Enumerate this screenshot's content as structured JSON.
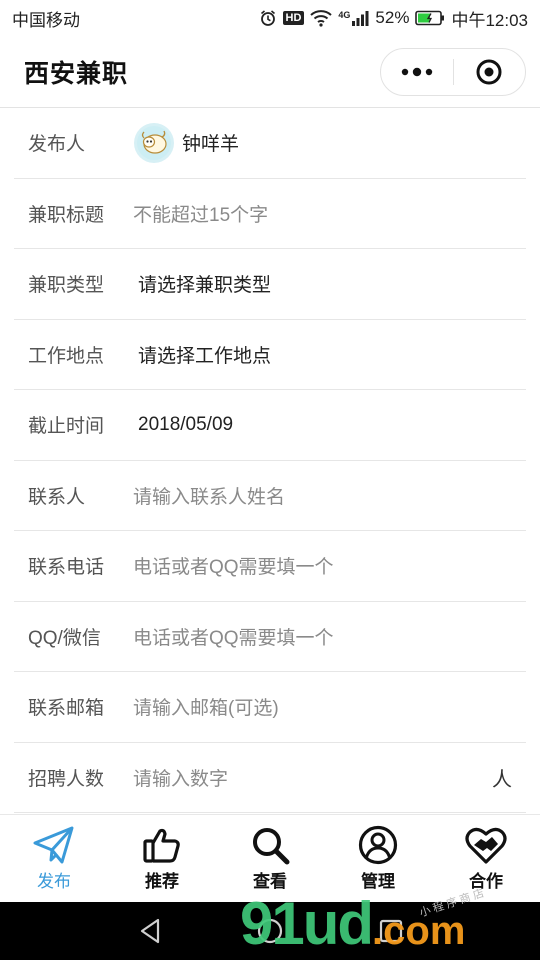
{
  "status_bar": {
    "carrier": "中国移动",
    "signal_tag": "4G",
    "battery": "52%",
    "time": "中午12:03",
    "hd": "HD"
  },
  "nav": {
    "title": "西安兼职"
  },
  "form": {
    "publisher": {
      "label": "发布人",
      "name": "钟咩羊"
    },
    "title": {
      "label": "兼职标题",
      "placeholder": "不能超过15个字"
    },
    "type": {
      "label": "兼职类型",
      "value": "请选择兼职类型"
    },
    "location": {
      "label": "工作地点",
      "value": "请选择工作地点"
    },
    "deadline": {
      "label": "截止时间",
      "value": "2018/05/09"
    },
    "contact": {
      "label": "联系人",
      "placeholder": "请输入联系人姓名"
    },
    "phone": {
      "label": "联系电话",
      "placeholder": "电话或者QQ需要填一个"
    },
    "qq": {
      "label": "QQ/微信",
      "placeholder": "电话或者QQ需要填一个"
    },
    "email": {
      "label": "联系邮箱",
      "placeholder": "请输入邮箱(可选)"
    },
    "headcount": {
      "label": "招聘人数",
      "placeholder": "请输入数字",
      "suffix": "人"
    }
  },
  "tabs": [
    {
      "label": "发布",
      "icon": "paper-plane-icon",
      "active": true
    },
    {
      "label": "推荐",
      "icon": "thumbs-up-icon",
      "active": false
    },
    {
      "label": "查看",
      "icon": "search-icon",
      "active": false
    },
    {
      "label": "管理",
      "icon": "user-circle-icon",
      "active": false
    },
    {
      "label": "合作",
      "icon": "handshake-heart-icon",
      "active": false
    }
  ],
  "watermark": {
    "main": "91ud",
    "suffix": ".com",
    "small": "小程序商店"
  },
  "colors": {
    "accent": "#3a9ad9",
    "watermark_green": "#3fc97a",
    "watermark_orange": "#f49a1c"
  }
}
